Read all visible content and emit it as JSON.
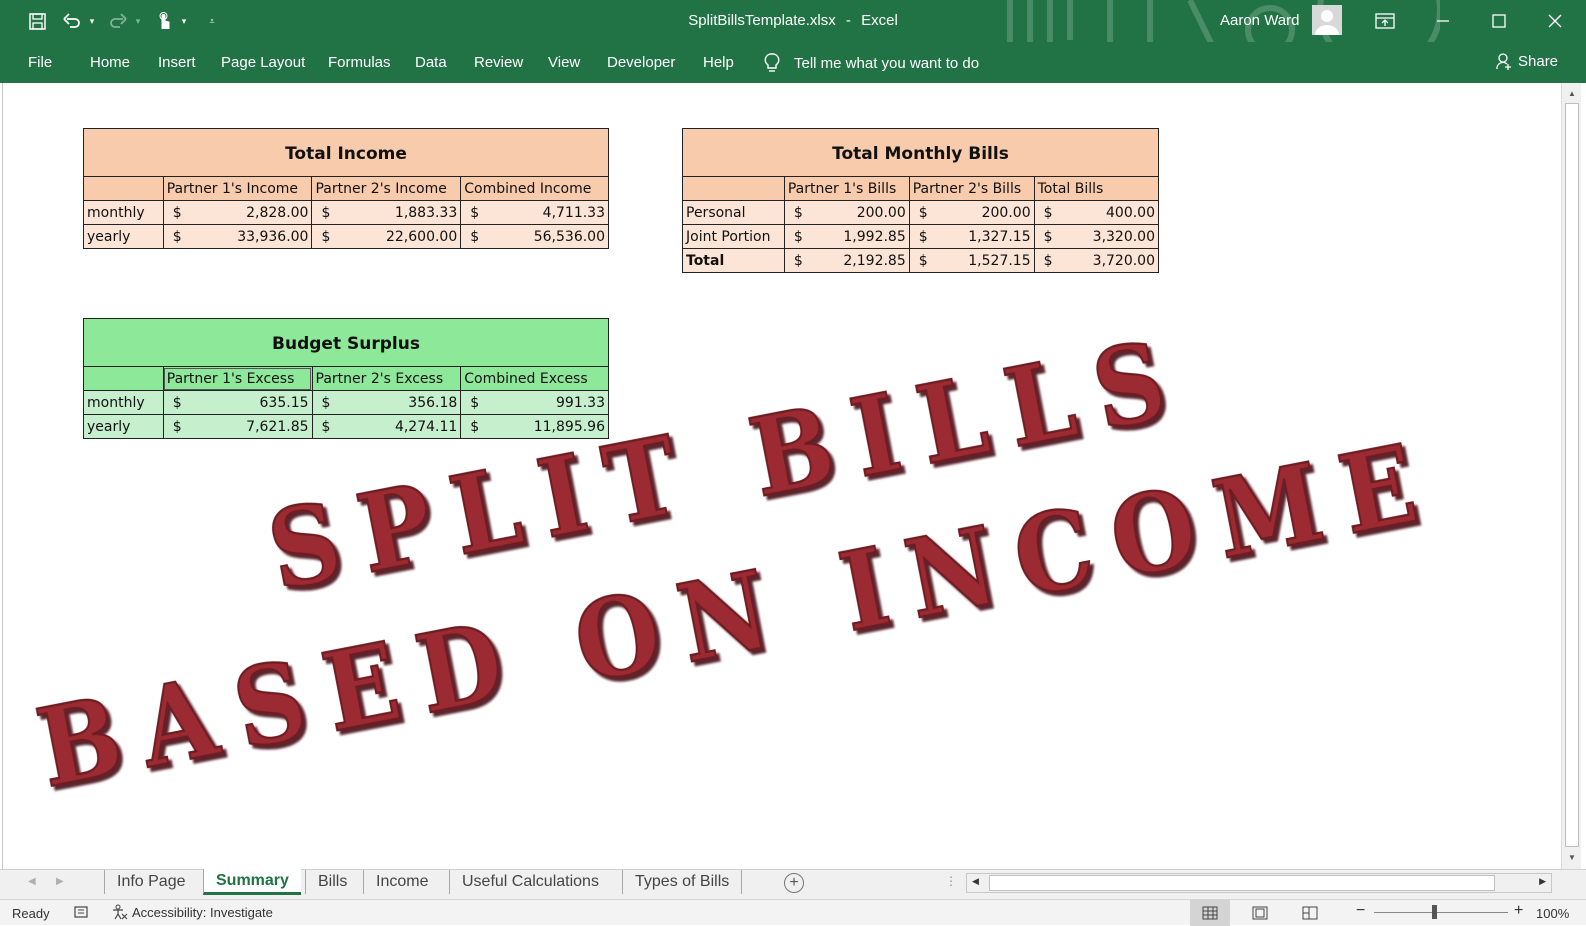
{
  "window": {
    "file_title": "SplitBillsTemplate.xlsx",
    "separator": "-",
    "app_name": "Excel",
    "user_name": "Aaron Ward"
  },
  "ribbon": {
    "tabs": [
      "File",
      "Home",
      "Insert",
      "Page Layout",
      "Formulas",
      "Data",
      "Review",
      "View",
      "Developer",
      "Help"
    ],
    "tell_me": "Tell me what you want to do",
    "share": "Share"
  },
  "sheet": {
    "income": {
      "title": "Total Income",
      "headers": [
        "",
        "Partner 1's Income",
        "Partner 2's Income",
        "Combined Income"
      ],
      "rows": [
        {
          "label": "monthly",
          "values": [
            "2,828.00",
            "1,883.33",
            "4,711.33"
          ]
        },
        {
          "label": "yearly",
          "values": [
            "33,936.00",
            "22,600.00",
            "56,536.00"
          ]
        }
      ]
    },
    "bills": {
      "title": "Total Monthly Bills",
      "headers": [
        "",
        "Partner 1's Bills",
        "Partner 2's Bills",
        "Total Bills"
      ],
      "rows": [
        {
          "label": "Personal",
          "values": [
            "200.00",
            "200.00",
            "400.00"
          ]
        },
        {
          "label": "Joint Portion",
          "values": [
            "1,992.85",
            "1,327.15",
            "3,320.00"
          ]
        },
        {
          "label": "Total",
          "values": [
            "2,192.85",
            "1,527.15",
            "3,720.00"
          ]
        }
      ]
    },
    "surplus": {
      "title": "Budget Surplus",
      "headers": [
        "",
        "Partner 1's Excess",
        "Partner 2's Excess",
        "Combined Excess"
      ],
      "rows": [
        {
          "label": "monthly",
          "values": [
            "635.15",
            "356.18",
            "991.33"
          ]
        },
        {
          "label": "yearly",
          "values": [
            "7,621.85",
            "4,274.11",
            "11,895.96"
          ]
        }
      ]
    },
    "currency_symbol": "$",
    "wordart": {
      "line1": "SPLIT BILLS",
      "line2": "BASED ON INCOME",
      "color": "#9b2a33"
    }
  },
  "sheet_tabs": {
    "tabs": [
      "Info Page",
      "Summary",
      "Bills",
      "Income",
      "Useful Calculations",
      "Types of Bills"
    ],
    "active": "Summary",
    "add_label": "+"
  },
  "status": {
    "ready": "Ready",
    "accessibility": "Accessibility: Investigate",
    "zoom": "100%"
  },
  "colors": {
    "excel_green": "#217346",
    "orange_header": "#f8cbad",
    "orange_cell": "#fce4d6",
    "green_header": "#8ee89a",
    "green_cell": "#c6efce"
  }
}
